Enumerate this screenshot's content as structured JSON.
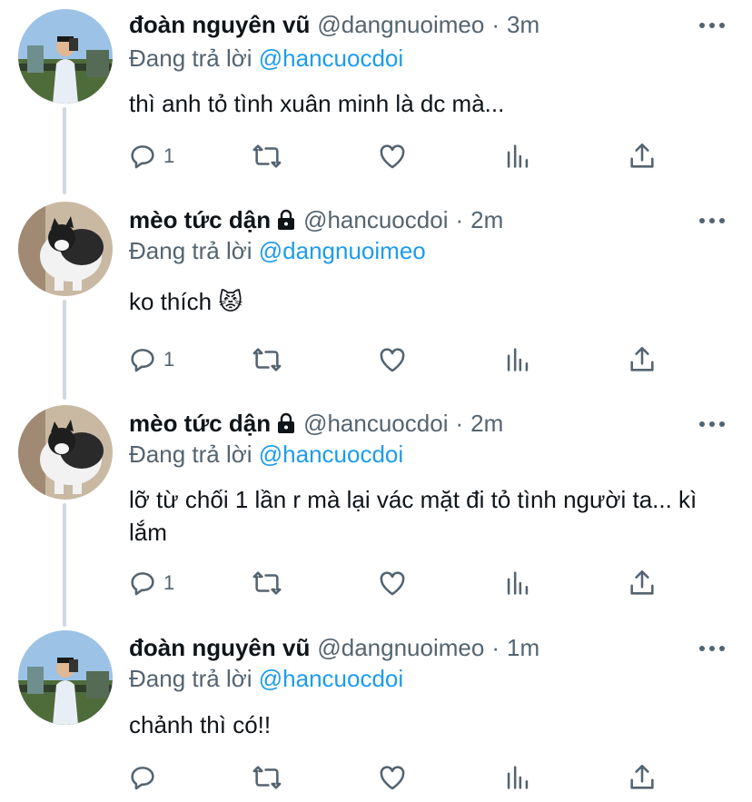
{
  "colors": {
    "text": "#0f1419",
    "secondary": "#536471",
    "link": "#1d9bf0",
    "thread_line": "#cfd9de"
  },
  "replying_prefix": "Đang trả lời",
  "tweets": [
    {
      "name": "đoàn nguyên vũ",
      "handle": "@dangnuoimeo",
      "time": "3m",
      "replying_to": "@hancuocdoi",
      "text": "thì anh tỏ tình xuân minh là dc mà...",
      "reply_count": "1",
      "avatar": "person-photo"
    },
    {
      "name": "mèo tức dận",
      "handle": "@hancuocdoi",
      "time": "2m",
      "replying_to": "@dangnuoimeo",
      "text": "ko thích 😾",
      "reply_count": "1",
      "avatar": "cat-photo"
    },
    {
      "name": "mèo tức dận",
      "handle": "@hancuocdoi",
      "time": "2m",
      "replying_to": "@hancuocdoi",
      "text": "lỡ từ chối 1 lần r mà lại vác mặt đi tỏ tình người ta... kì lắm",
      "reply_count": "1",
      "avatar": "cat-photo"
    },
    {
      "name": "đoàn nguyên vũ",
      "handle": "@dangnuoimeo",
      "time": "1m",
      "replying_to": "@hancuocdoi",
      "text": "chảnh thì có!!",
      "reply_count": "",
      "avatar": "person-photo"
    }
  ]
}
